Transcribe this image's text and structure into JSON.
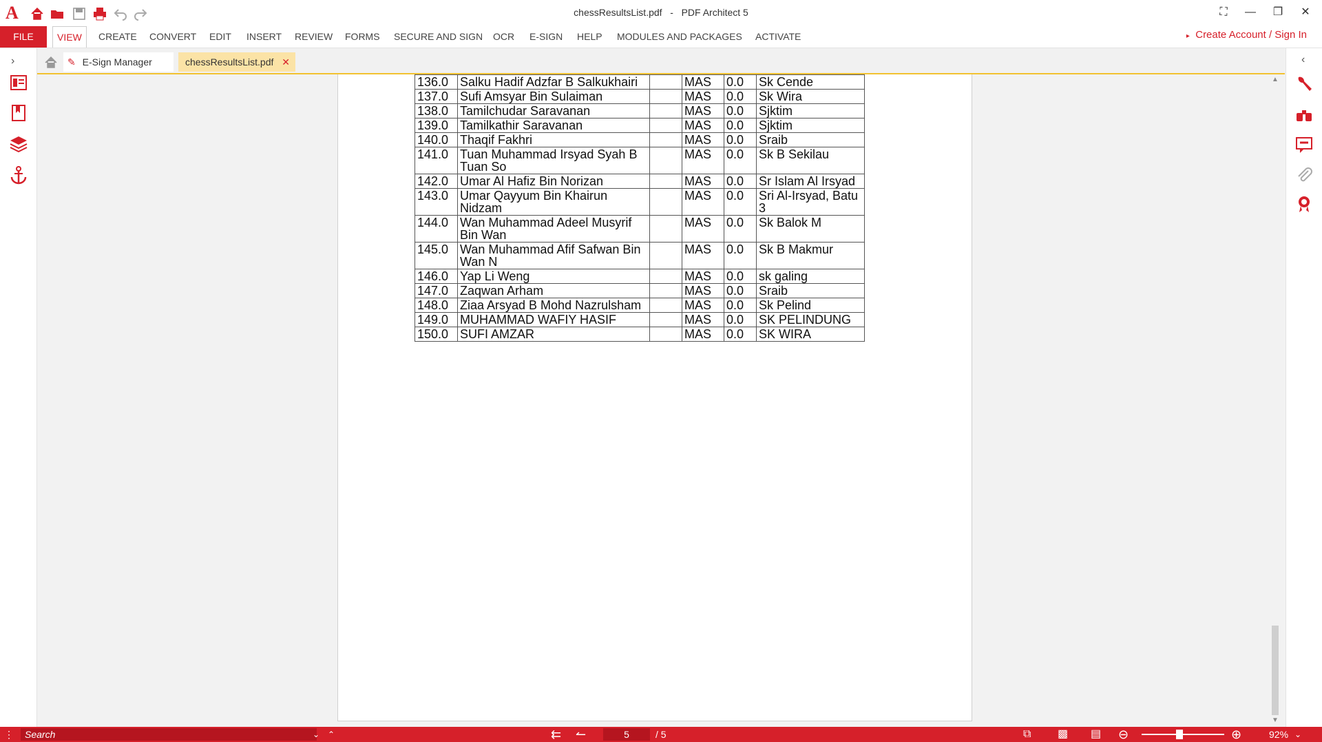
{
  "window": {
    "title_file": "chessResultsList.pdf",
    "title_sep": "-",
    "title_app": "PDF Architect 5",
    "controls": [
      "⛶",
      "—",
      "❐",
      "✕"
    ]
  },
  "menubar": {
    "file": "FILE",
    "items": [
      "VIEW",
      "CREATE",
      "CONVERT",
      "EDIT",
      "INSERT",
      "REVIEW",
      "FORMS",
      "SECURE AND SIGN",
      "OCR",
      "E-SIGN",
      "HELP",
      "MODULES AND PACKAGES",
      "ACTIVATE"
    ],
    "create_account": "Create Account / Sign In"
  },
  "doc_tabs": {
    "esign": "E-Sign Manager",
    "file": "chessResultsList.pdf"
  },
  "table": {
    "rows": [
      [
        "136.0",
        "Salku Hadif Adzfar B Salkukhairi",
        "",
        "MAS",
        "0.0",
        "Sk Cende"
      ],
      [
        "137.0",
        "Sufi Amsyar Bin Sulaiman",
        "",
        "MAS",
        "0.0",
        "Sk Wira"
      ],
      [
        "138.0",
        "Tamilchudar Saravanan",
        "",
        "MAS",
        "0.0",
        "Sjktim"
      ],
      [
        "139.0",
        "Tamilkathir Saravanan",
        "",
        "MAS",
        "0.0",
        "Sjktim"
      ],
      [
        "140.0",
        "Thaqif Fakhri",
        "",
        "MAS",
        "0.0",
        "Sraib"
      ],
      [
        "141.0",
        "Tuan Muhammad Irsyad Syah B Tuan So",
        "",
        "MAS",
        "0.0",
        "Sk B Sekilau"
      ],
      [
        "142.0",
        "Umar Al Hafiz Bin Norizan",
        "",
        "MAS",
        "0.0",
        "Sr Islam Al Irsyad"
      ],
      [
        "143.0",
        "Umar Qayyum Bin Khairun Nidzam",
        "",
        "MAS",
        "0.0",
        "Sri Al-Irsyad, Batu 3"
      ],
      [
        "144.0",
        "Wan Muhammad Adeel Musyrif Bin Wan",
        "",
        "MAS",
        "0.0",
        "Sk Balok M"
      ],
      [
        "145.0",
        "Wan Muhammad Afif Safwan Bin Wan N",
        "",
        "MAS",
        "0.0",
        "Sk B Makmur"
      ],
      [
        "146.0",
        "Yap Li Weng",
        "",
        "MAS",
        "0.0",
        "sk galing"
      ],
      [
        "147.0",
        "Zaqwan Arham",
        "",
        "MAS",
        "0.0",
        "Sraib"
      ],
      [
        "148.0",
        "Ziaa Arsyad B Mohd Nazrulsham",
        "",
        "MAS",
        "0.0",
        "Sk Pelind"
      ],
      [
        "149.0",
        "MUHAMMAD WAFIY HASIF",
        "",
        "MAS",
        "0.0",
        "SK PELINDUNG"
      ],
      [
        "150.0",
        "SUFI AMZAR",
        "",
        "MAS",
        "0.0",
        "SK WIRA"
      ]
    ]
  },
  "statusbar": {
    "search_placeholder": "Search",
    "current_page": "5",
    "total_pages": "/ 5",
    "zoom": "92%",
    "zoom_level": 0.46
  },
  "colors": {
    "accent": "#d6202a",
    "tab_highlight": "#f2c230"
  }
}
